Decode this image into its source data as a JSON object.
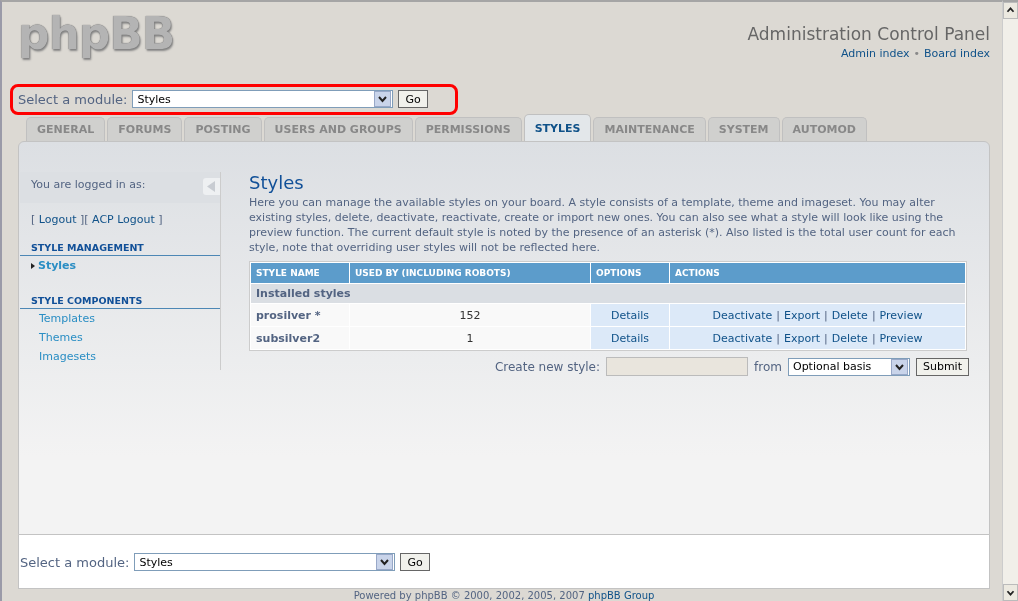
{
  "header": {
    "logo": "phpBB",
    "title": "Administration Control Panel",
    "links": [
      "Admin index",
      "Board index"
    ],
    "separator": "•"
  },
  "module_select_top": {
    "label": "Select a module:",
    "value": "Styles",
    "button": "Go",
    "highlighted": true
  },
  "tabs": [
    {
      "label": "GENERAL",
      "selected": false
    },
    {
      "label": "FORUMS",
      "selected": false
    },
    {
      "label": "POSTING",
      "selected": false
    },
    {
      "label": "USERS AND GROUPS",
      "selected": false
    },
    {
      "label": "PERMISSIONS",
      "selected": false
    },
    {
      "label": "STYLES",
      "selected": true
    },
    {
      "label": "MAINTENANCE",
      "selected": false
    },
    {
      "label": "SYSTEM",
      "selected": false
    },
    {
      "label": "AUTOMOD",
      "selected": false
    }
  ],
  "sidebar": {
    "logged_in": "You are logged in as:",
    "logout_line": [
      {
        "kind": "text",
        "text": "[ "
      },
      {
        "kind": "link",
        "text": "Logout"
      },
      {
        "kind": "text",
        "text": " ][ "
      },
      {
        "kind": "link",
        "text": "ACP Logout"
      },
      {
        "kind": "text",
        "text": " ]"
      }
    ],
    "sections": [
      {
        "heading": "STYLE MANAGEMENT",
        "items": [
          {
            "label": "Styles",
            "selected": true
          }
        ]
      },
      {
        "heading": "STYLE COMPONENTS",
        "items": [
          {
            "label": "Templates",
            "selected": false
          },
          {
            "label": "Themes",
            "selected": false
          },
          {
            "label": "Imagesets",
            "selected": false
          }
        ]
      }
    ]
  },
  "content": {
    "title": "Styles",
    "description": "Here you can manage the available styles on your board. A style consists of a template, theme and imageset. You may alter existing styles, delete, deactivate, reactivate, create or import new ones. You can also see what a style will look like using the preview function. The current default style is noted by the presence of an asterisk (*). Also listed is the total user count for each style, note that overriding user styles will not be reflected here.",
    "table": {
      "columns": [
        "STYLE NAME",
        "USED BY (INCLUDING ROBOTS)",
        "OPTIONS",
        "ACTIONS"
      ],
      "group": "Installed styles",
      "action_separator": "|",
      "rows": [
        {
          "name": "prosilver *",
          "used_by": "152",
          "options": "Details",
          "actions": [
            "Deactivate",
            "Export",
            "Delete",
            "Preview"
          ]
        },
        {
          "name": "subsilver2",
          "used_by": "1",
          "options": "Details",
          "actions": [
            "Deactivate",
            "Export",
            "Delete",
            "Preview"
          ]
        }
      ]
    },
    "create": {
      "label": "Create new style:",
      "from": "from",
      "basis": "Optional basis",
      "button": "Submit"
    }
  },
  "module_select_bottom": {
    "label": "Select a module:",
    "value": "Styles",
    "button": "Go",
    "highlighted": false
  },
  "footer": {
    "text": "Powered by phpBB © 2000, 2002, 2005, 2007",
    "link": "phpBB Group"
  }
}
